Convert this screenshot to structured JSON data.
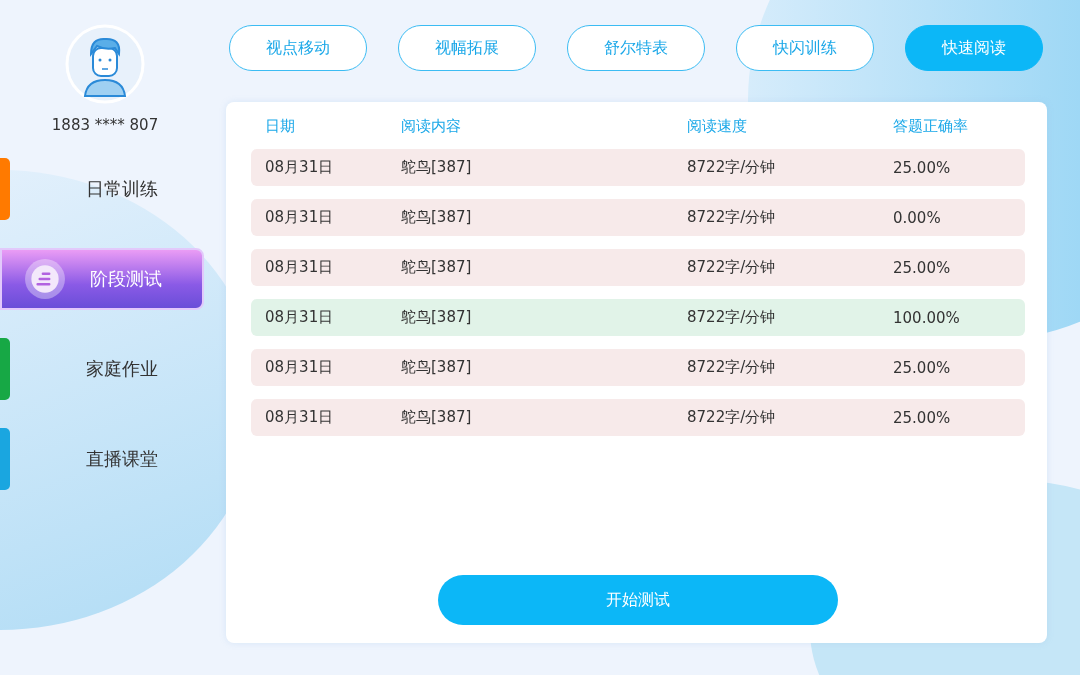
{
  "user": {
    "phone": "1883 **** 807"
  },
  "sidebar": {
    "items": [
      {
        "label": "日常训练",
        "selected": false,
        "color": "#ff7a00"
      },
      {
        "label": "阶段测试",
        "selected": true,
        "color": "#8a5ae6"
      },
      {
        "label": "家庭作业",
        "selected": false,
        "color": "#17a845"
      },
      {
        "label": "直播课堂",
        "selected": false,
        "color": "#1aa6e0"
      }
    ]
  },
  "tabs": [
    {
      "label": "视点移动",
      "selected": false
    },
    {
      "label": "视幅拓展",
      "selected": false
    },
    {
      "label": "舒尔特表",
      "selected": false
    },
    {
      "label": "快闪训练",
      "selected": false
    },
    {
      "label": "快速阅读",
      "selected": true
    }
  ],
  "table": {
    "columns": [
      "日期",
      "阅读内容",
      "阅读速度",
      "答题正确率"
    ],
    "rows": [
      {
        "cells": [
          "08月31日",
          "鸵鸟[387]",
          "8722字/分钟",
          "25.00%"
        ],
        "color": "#f7eaea"
      },
      {
        "cells": [
          "08月31日",
          "鸵鸟[387]",
          "8722字/分钟",
          "0.00%"
        ],
        "color": "#f7eaea"
      },
      {
        "cells": [
          "08月31日",
          "鸵鸟[387]",
          "8722字/分钟",
          "25.00%"
        ],
        "color": "#f7eaea"
      },
      {
        "cells": [
          "08月31日",
          "鸵鸟[387]",
          "8722字/分钟",
          "100.00%"
        ],
        "color": "#e1f3e8"
      },
      {
        "cells": [
          "08月31日",
          "鸵鸟[387]",
          "8722字/分钟",
          "25.00%"
        ],
        "color": "#f7eaea"
      },
      {
        "cells": [
          "08月31日",
          "鸵鸟[387]",
          "8722字/分钟",
          "25.00%"
        ],
        "color": "#f7eaea"
      }
    ]
  },
  "start_button": "开始测试"
}
